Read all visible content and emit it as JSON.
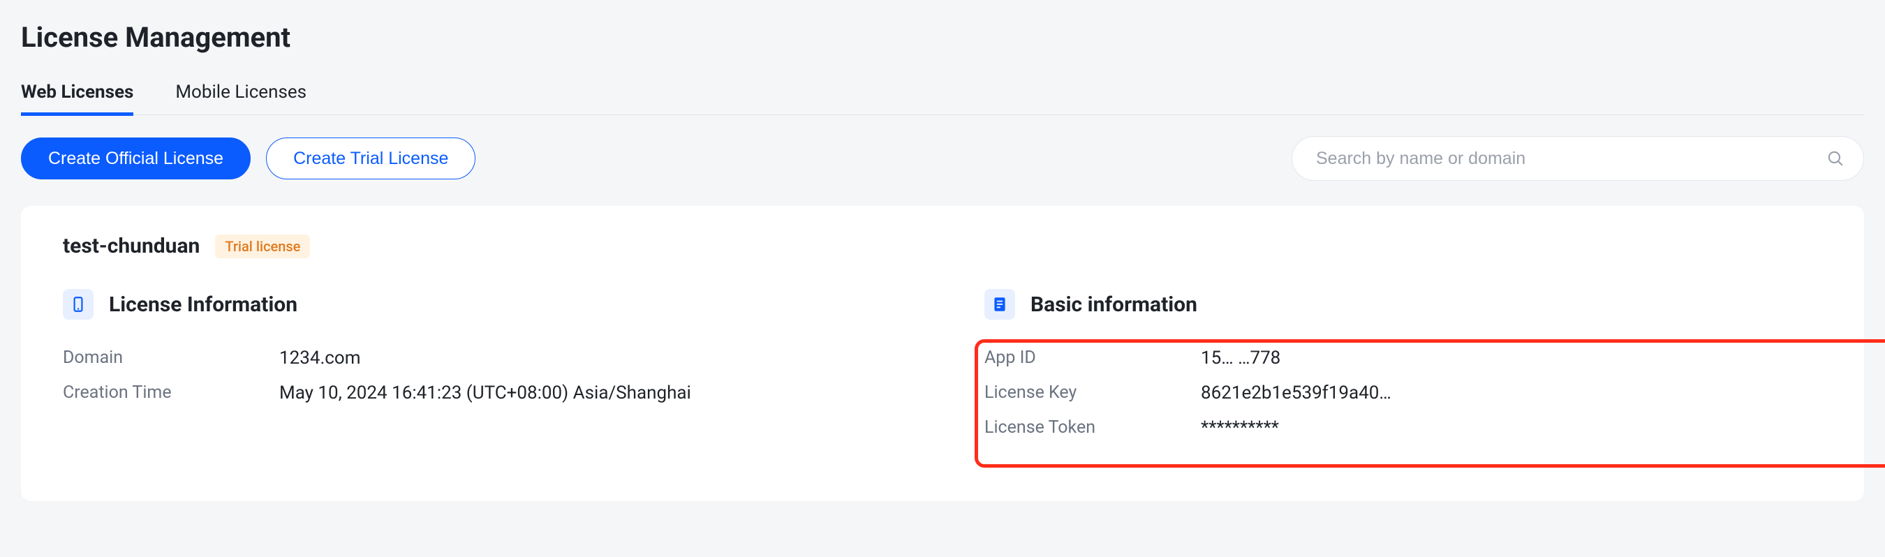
{
  "title": "License Management",
  "tabs": {
    "web": "Web Licenses",
    "mobile": "Mobile Licenses"
  },
  "toolbar": {
    "create_official": "Create Official License",
    "create_trial": "Create Trial License",
    "search_placeholder": "Search by name or domain"
  },
  "license": {
    "name": "test-chunduan",
    "badge": "Trial license",
    "info_heading": "License Information",
    "domain_label": "Domain",
    "domain_value": "1234.com",
    "created_label": "Creation Time",
    "created_value": "May 10, 2024 16:41:23 (UTC+08:00) Asia/Shanghai",
    "basic_heading": "Basic information",
    "appid_label": "App ID",
    "appid_value": "15…   …778",
    "key_label": "License Key",
    "key_value": "8621e2b1e539f19a40…",
    "token_label": "License Token",
    "token_value": "**********"
  }
}
